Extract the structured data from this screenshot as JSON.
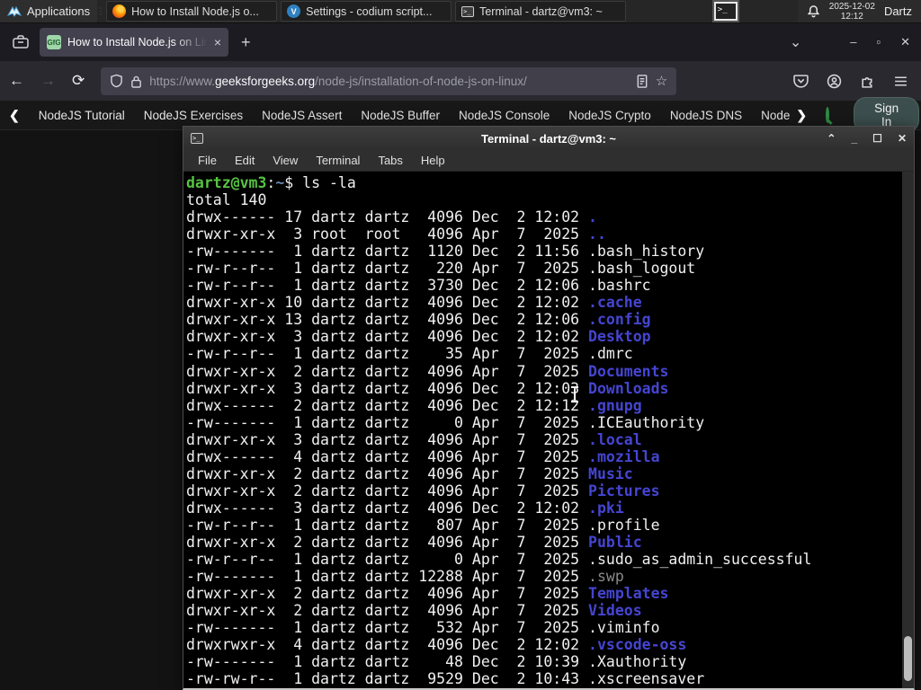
{
  "panel": {
    "applications_label": "Applications",
    "windows": [
      {
        "label": "How to Install Node.js o...",
        "icon": "firefox"
      },
      {
        "label": "Settings - codium script...",
        "icon": "codium"
      },
      {
        "label": "Terminal - dartz@vm3: ~",
        "icon": "terminal"
      }
    ],
    "clock_date": "2025-12-02",
    "clock_time": "12:12",
    "user": "Dartz"
  },
  "browser": {
    "tab_title": "How to Install Node.js on Linux",
    "new_tab_label": "+",
    "close_tab_label": "×",
    "url_scheme": "https://www.",
    "url_domain": "geeksforgeeks.org",
    "url_path": "/node-js/installation-of-node-js-on-linux/",
    "favicon_text": "GfG",
    "site_nav_items": [
      "NodeJS Tutorial",
      "NodeJS Exercises",
      "NodeJS Assert",
      "NodeJS Buffer",
      "NodeJS Console",
      "NodeJS Crypto",
      "NodeJS DNS",
      "Node"
    ],
    "sign_in_label": "Sign In"
  },
  "terminal": {
    "title": "Terminal - dartz@vm3: ~",
    "menu": [
      "File",
      "Edit",
      "View",
      "Terminal",
      "Tabs",
      "Help"
    ],
    "prompt_user_host": "dartz@vm3",
    "prompt_colon": ":",
    "prompt_path": "~",
    "prompt_suffix": "$ ",
    "command": "ls -la",
    "total_line": "total 140",
    "entries": [
      {
        "p": "drwx------",
        "n": "17",
        "o": "dartz",
        "g": "dartz",
        "s": "4096",
        "m": "Dec",
        "d": "2",
        "t": "12:02",
        "f": ".",
        "c": "d"
      },
      {
        "p": "drwxr-xr-x",
        "n": "3",
        "o": "root",
        "g": "root",
        "s": "4096",
        "m": "Apr",
        "d": "7",
        "t": "2025",
        "f": "..",
        "c": "d"
      },
      {
        "p": "-rw-------",
        "n": "1",
        "o": "dartz",
        "g": "dartz",
        "s": "1120",
        "m": "Dec",
        "d": "2",
        "t": "11:56",
        "f": ".bash_history",
        "c": "f"
      },
      {
        "p": "-rw-r--r--",
        "n": "1",
        "o": "dartz",
        "g": "dartz",
        "s": "220",
        "m": "Apr",
        "d": "7",
        "t": "2025",
        "f": ".bash_logout",
        "c": "f"
      },
      {
        "p": "-rw-r--r--",
        "n": "1",
        "o": "dartz",
        "g": "dartz",
        "s": "3730",
        "m": "Dec",
        "d": "2",
        "t": "12:06",
        "f": ".bashrc",
        "c": "f"
      },
      {
        "p": "drwxr-xr-x",
        "n": "10",
        "o": "dartz",
        "g": "dartz",
        "s": "4096",
        "m": "Dec",
        "d": "2",
        "t": "12:02",
        "f": ".cache",
        "c": "d"
      },
      {
        "p": "drwxr-xr-x",
        "n": "13",
        "o": "dartz",
        "g": "dartz",
        "s": "4096",
        "m": "Dec",
        "d": "2",
        "t": "12:06",
        "f": ".config",
        "c": "d"
      },
      {
        "p": "drwxr-xr-x",
        "n": "3",
        "o": "dartz",
        "g": "dartz",
        "s": "4096",
        "m": "Dec",
        "d": "2",
        "t": "12:02",
        "f": "Desktop",
        "c": "d"
      },
      {
        "p": "-rw-r--r--",
        "n": "1",
        "o": "dartz",
        "g": "dartz",
        "s": "35",
        "m": "Apr",
        "d": "7",
        "t": "2025",
        "f": ".dmrc",
        "c": "f"
      },
      {
        "p": "drwxr-xr-x",
        "n": "2",
        "o": "dartz",
        "g": "dartz",
        "s": "4096",
        "m": "Apr",
        "d": "7",
        "t": "2025",
        "f": "Documents",
        "c": "d"
      },
      {
        "p": "drwxr-xr-x",
        "n": "3",
        "o": "dartz",
        "g": "dartz",
        "s": "4096",
        "m": "Dec",
        "d": "2",
        "t": "12:03",
        "f": "Downloads",
        "c": "d"
      },
      {
        "p": "drwx------",
        "n": "2",
        "o": "dartz",
        "g": "dartz",
        "s": "4096",
        "m": "Dec",
        "d": "2",
        "t": "12:12",
        "f": ".gnupg",
        "c": "d"
      },
      {
        "p": "-rw-------",
        "n": "1",
        "o": "dartz",
        "g": "dartz",
        "s": "0",
        "m": "Apr",
        "d": "7",
        "t": "2025",
        "f": ".ICEauthority",
        "c": "f"
      },
      {
        "p": "drwxr-xr-x",
        "n": "3",
        "o": "dartz",
        "g": "dartz",
        "s": "4096",
        "m": "Apr",
        "d": "7",
        "t": "2025",
        "f": ".local",
        "c": "d"
      },
      {
        "p": "drwx------",
        "n": "4",
        "o": "dartz",
        "g": "dartz",
        "s": "4096",
        "m": "Apr",
        "d": "7",
        "t": "2025",
        "f": ".mozilla",
        "c": "d"
      },
      {
        "p": "drwxr-xr-x",
        "n": "2",
        "o": "dartz",
        "g": "dartz",
        "s": "4096",
        "m": "Apr",
        "d": "7",
        "t": "2025",
        "f": "Music",
        "c": "d"
      },
      {
        "p": "drwxr-xr-x",
        "n": "2",
        "o": "dartz",
        "g": "dartz",
        "s": "4096",
        "m": "Apr",
        "d": "7",
        "t": "2025",
        "f": "Pictures",
        "c": "d"
      },
      {
        "p": "drwx------",
        "n": "3",
        "o": "dartz",
        "g": "dartz",
        "s": "4096",
        "m": "Dec",
        "d": "2",
        "t": "12:02",
        "f": ".pki",
        "c": "d"
      },
      {
        "p": "-rw-r--r--",
        "n": "1",
        "o": "dartz",
        "g": "dartz",
        "s": "807",
        "m": "Apr",
        "d": "7",
        "t": "2025",
        "f": ".profile",
        "c": "f"
      },
      {
        "p": "drwxr-xr-x",
        "n": "2",
        "o": "dartz",
        "g": "dartz",
        "s": "4096",
        "m": "Apr",
        "d": "7",
        "t": "2025",
        "f": "Public",
        "c": "d"
      },
      {
        "p": "-rw-r--r--",
        "n": "1",
        "o": "dartz",
        "g": "dartz",
        "s": "0",
        "m": "Apr",
        "d": "7",
        "t": "2025",
        "f": ".sudo_as_admin_successful",
        "c": "f"
      },
      {
        "p": "-rw-------",
        "n": "1",
        "o": "dartz",
        "g": "dartz",
        "s": "12288",
        "m": "Apr",
        "d": "7",
        "t": "2025",
        "f": ".swp",
        "c": "x"
      },
      {
        "p": "drwxr-xr-x",
        "n": "2",
        "o": "dartz",
        "g": "dartz",
        "s": "4096",
        "m": "Apr",
        "d": "7",
        "t": "2025",
        "f": "Templates",
        "c": "d"
      },
      {
        "p": "drwxr-xr-x",
        "n": "2",
        "o": "dartz",
        "g": "dartz",
        "s": "4096",
        "m": "Apr",
        "d": "7",
        "t": "2025",
        "f": "Videos",
        "c": "d"
      },
      {
        "p": "-rw-------",
        "n": "1",
        "o": "dartz",
        "g": "dartz",
        "s": "532",
        "m": "Apr",
        "d": "7",
        "t": "2025",
        "f": ".viminfo",
        "c": "f"
      },
      {
        "p": "drwxrwxr-x",
        "n": "4",
        "o": "dartz",
        "g": "dartz",
        "s": "4096",
        "m": "Dec",
        "d": "2",
        "t": "12:02",
        "f": ".vscode-oss",
        "c": "d"
      },
      {
        "p": "-rw-------",
        "n": "1",
        "o": "dartz",
        "g": "dartz",
        "s": "48",
        "m": "Dec",
        "d": "2",
        "t": "10:39",
        "f": ".Xauthority",
        "c": "f"
      },
      {
        "p": "-rw-rw-r--",
        "n": "1",
        "o": "dartz",
        "g": "dartz",
        "s": "9529",
        "m": "Dec",
        "d": "2",
        "t": "10:43",
        "f": ".xscreensaver",
        "c": "f"
      }
    ]
  },
  "colors": {
    "dir_blue": "#4545d2",
    "prompt_green": "#57c443",
    "gfg_green": "#2f8d46",
    "accent_bg": "#42414d"
  }
}
